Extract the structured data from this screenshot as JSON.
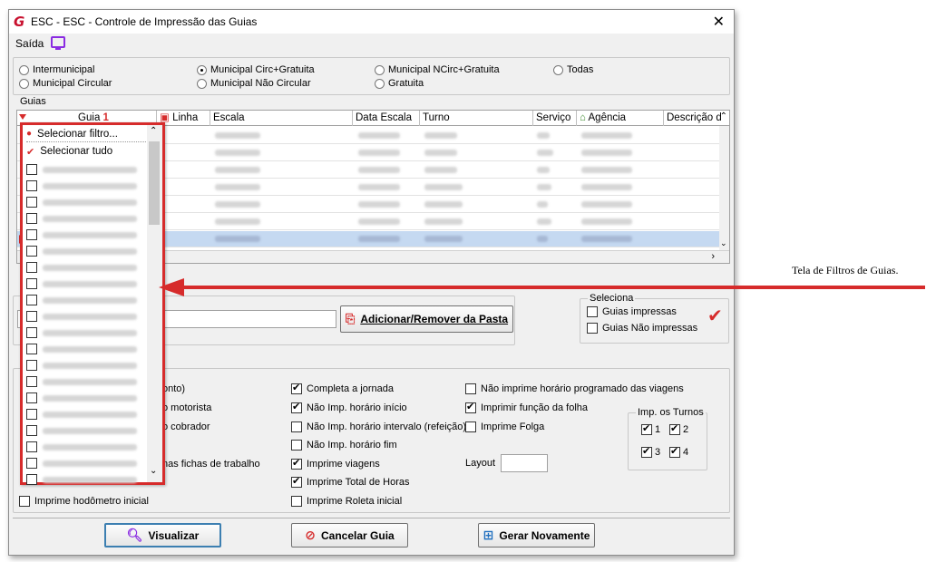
{
  "window": {
    "title": "ESC -  ESC - Controle de Impressão das Guias"
  },
  "menu": {
    "saida": "Saída"
  },
  "radios": [
    {
      "label": "Intermunicipal",
      "selected": false
    },
    {
      "label": "Municipal Circ+Gratuita",
      "selected": true
    },
    {
      "label": "Municipal NCirc+Gratuita",
      "selected": false
    },
    {
      "label": "Todas",
      "selected": false
    },
    {
      "label": "Municipal Circular",
      "selected": false
    },
    {
      "label": "Municipal Não Circular",
      "selected": false
    },
    {
      "label": "Gratuita",
      "selected": false
    }
  ],
  "guias": {
    "group_label": "Guias",
    "columns": [
      "Guia",
      "Linha",
      "Escala",
      "Data Escala",
      "Turno",
      "Serviço",
      "Agência",
      "Descrição da"
    ],
    "sort_marker": "1"
  },
  "dropdown": {
    "filter_label": "Selecionar filtro...",
    "select_all_label": "Selecionar tudo"
  },
  "folder": {
    "button_label": "Adicionar/Remover da Pasta"
  },
  "seleciona": {
    "label": "Seleciona",
    "options": [
      "Guias impressas",
      "Guias Não impressas"
    ]
  },
  "options": {
    "left_fragments": [
      "onto)",
      "o motorista",
      "o cobrador",
      "nas fichas de trabalho"
    ],
    "hodometro": "Imprime hodômetro inicial",
    "mid": [
      {
        "label": "Completa a jornada",
        "checked": true
      },
      {
        "label": "Não Imp. horário início",
        "checked": true
      },
      {
        "label": "Não Imp. horário intervalo (refeição)",
        "checked": false
      },
      {
        "label": "Não Imp. horário fim",
        "checked": false
      },
      {
        "label": "Imprime viagens",
        "checked": true
      },
      {
        "label": "Imprime Total de Horas",
        "checked": true
      },
      {
        "label": "Imprime Roleta inicial",
        "checked": false
      }
    ],
    "right": [
      {
        "label": "Não imprime horário programado das viagens",
        "checked": false
      },
      {
        "label": "Imprimir função da folha",
        "checked": true
      },
      {
        "label": "Imprime Folga",
        "checked": false
      }
    ],
    "layout_label": "Layout",
    "turnos": {
      "label": "Imp. os Turnos",
      "items": [
        {
          "label": "1",
          "checked": true
        },
        {
          "label": "2",
          "checked": true
        },
        {
          "label": "3",
          "checked": true
        },
        {
          "label": "4",
          "checked": true
        }
      ]
    }
  },
  "buttons": {
    "visualizar": "Visualizar",
    "cancelar": "Cancelar Guia",
    "gerar": "Gerar Novamente"
  },
  "annotation": {
    "text": "Tela de Filtros de Guias."
  },
  "colors": {
    "highlight_red": "#d62b2b",
    "selection_blue": "#c5d9f1",
    "purple": "#8a2be2"
  }
}
